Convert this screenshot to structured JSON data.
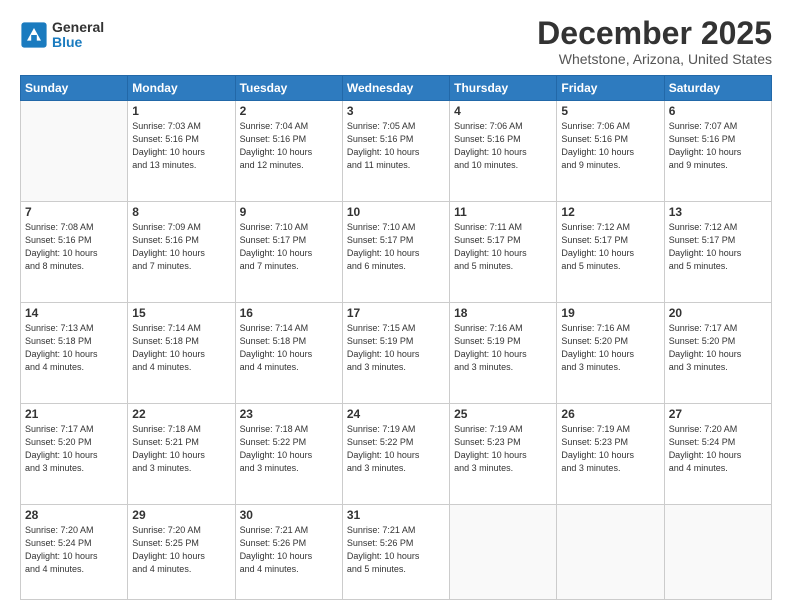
{
  "header": {
    "logo": {
      "general": "General",
      "blue": "Blue"
    },
    "title": "December 2025",
    "location": "Whetstone, Arizona, United States"
  },
  "weekdays": [
    "Sunday",
    "Monday",
    "Tuesday",
    "Wednesday",
    "Thursday",
    "Friday",
    "Saturday"
  ],
  "weeks": [
    [
      {
        "day": "",
        "info": ""
      },
      {
        "day": "1",
        "info": "Sunrise: 7:03 AM\nSunset: 5:16 PM\nDaylight: 10 hours\nand 13 minutes."
      },
      {
        "day": "2",
        "info": "Sunrise: 7:04 AM\nSunset: 5:16 PM\nDaylight: 10 hours\nand 12 minutes."
      },
      {
        "day": "3",
        "info": "Sunrise: 7:05 AM\nSunset: 5:16 PM\nDaylight: 10 hours\nand 11 minutes."
      },
      {
        "day": "4",
        "info": "Sunrise: 7:06 AM\nSunset: 5:16 PM\nDaylight: 10 hours\nand 10 minutes."
      },
      {
        "day": "5",
        "info": "Sunrise: 7:06 AM\nSunset: 5:16 PM\nDaylight: 10 hours\nand 9 minutes."
      },
      {
        "day": "6",
        "info": "Sunrise: 7:07 AM\nSunset: 5:16 PM\nDaylight: 10 hours\nand 9 minutes."
      }
    ],
    [
      {
        "day": "7",
        "info": "Sunrise: 7:08 AM\nSunset: 5:16 PM\nDaylight: 10 hours\nand 8 minutes."
      },
      {
        "day": "8",
        "info": "Sunrise: 7:09 AM\nSunset: 5:16 PM\nDaylight: 10 hours\nand 7 minutes."
      },
      {
        "day": "9",
        "info": "Sunrise: 7:10 AM\nSunset: 5:17 PM\nDaylight: 10 hours\nand 7 minutes."
      },
      {
        "day": "10",
        "info": "Sunrise: 7:10 AM\nSunset: 5:17 PM\nDaylight: 10 hours\nand 6 minutes."
      },
      {
        "day": "11",
        "info": "Sunrise: 7:11 AM\nSunset: 5:17 PM\nDaylight: 10 hours\nand 5 minutes."
      },
      {
        "day": "12",
        "info": "Sunrise: 7:12 AM\nSunset: 5:17 PM\nDaylight: 10 hours\nand 5 minutes."
      },
      {
        "day": "13",
        "info": "Sunrise: 7:12 AM\nSunset: 5:17 PM\nDaylight: 10 hours\nand 5 minutes."
      }
    ],
    [
      {
        "day": "14",
        "info": "Sunrise: 7:13 AM\nSunset: 5:18 PM\nDaylight: 10 hours\nand 4 minutes."
      },
      {
        "day": "15",
        "info": "Sunrise: 7:14 AM\nSunset: 5:18 PM\nDaylight: 10 hours\nand 4 minutes."
      },
      {
        "day": "16",
        "info": "Sunrise: 7:14 AM\nSunset: 5:18 PM\nDaylight: 10 hours\nand 4 minutes."
      },
      {
        "day": "17",
        "info": "Sunrise: 7:15 AM\nSunset: 5:19 PM\nDaylight: 10 hours\nand 3 minutes."
      },
      {
        "day": "18",
        "info": "Sunrise: 7:16 AM\nSunset: 5:19 PM\nDaylight: 10 hours\nand 3 minutes."
      },
      {
        "day": "19",
        "info": "Sunrise: 7:16 AM\nSunset: 5:20 PM\nDaylight: 10 hours\nand 3 minutes."
      },
      {
        "day": "20",
        "info": "Sunrise: 7:17 AM\nSunset: 5:20 PM\nDaylight: 10 hours\nand 3 minutes."
      }
    ],
    [
      {
        "day": "21",
        "info": "Sunrise: 7:17 AM\nSunset: 5:20 PM\nDaylight: 10 hours\nand 3 minutes."
      },
      {
        "day": "22",
        "info": "Sunrise: 7:18 AM\nSunset: 5:21 PM\nDaylight: 10 hours\nand 3 minutes."
      },
      {
        "day": "23",
        "info": "Sunrise: 7:18 AM\nSunset: 5:22 PM\nDaylight: 10 hours\nand 3 minutes."
      },
      {
        "day": "24",
        "info": "Sunrise: 7:19 AM\nSunset: 5:22 PM\nDaylight: 10 hours\nand 3 minutes."
      },
      {
        "day": "25",
        "info": "Sunrise: 7:19 AM\nSunset: 5:23 PM\nDaylight: 10 hours\nand 3 minutes."
      },
      {
        "day": "26",
        "info": "Sunrise: 7:19 AM\nSunset: 5:23 PM\nDaylight: 10 hours\nand 3 minutes."
      },
      {
        "day": "27",
        "info": "Sunrise: 7:20 AM\nSunset: 5:24 PM\nDaylight: 10 hours\nand 4 minutes."
      }
    ],
    [
      {
        "day": "28",
        "info": "Sunrise: 7:20 AM\nSunset: 5:24 PM\nDaylight: 10 hours\nand 4 minutes."
      },
      {
        "day": "29",
        "info": "Sunrise: 7:20 AM\nSunset: 5:25 PM\nDaylight: 10 hours\nand 4 minutes."
      },
      {
        "day": "30",
        "info": "Sunrise: 7:21 AM\nSunset: 5:26 PM\nDaylight: 10 hours\nand 4 minutes."
      },
      {
        "day": "31",
        "info": "Sunrise: 7:21 AM\nSunset: 5:26 PM\nDaylight: 10 hours\nand 5 minutes."
      },
      {
        "day": "",
        "info": ""
      },
      {
        "day": "",
        "info": ""
      },
      {
        "day": "",
        "info": ""
      }
    ]
  ]
}
